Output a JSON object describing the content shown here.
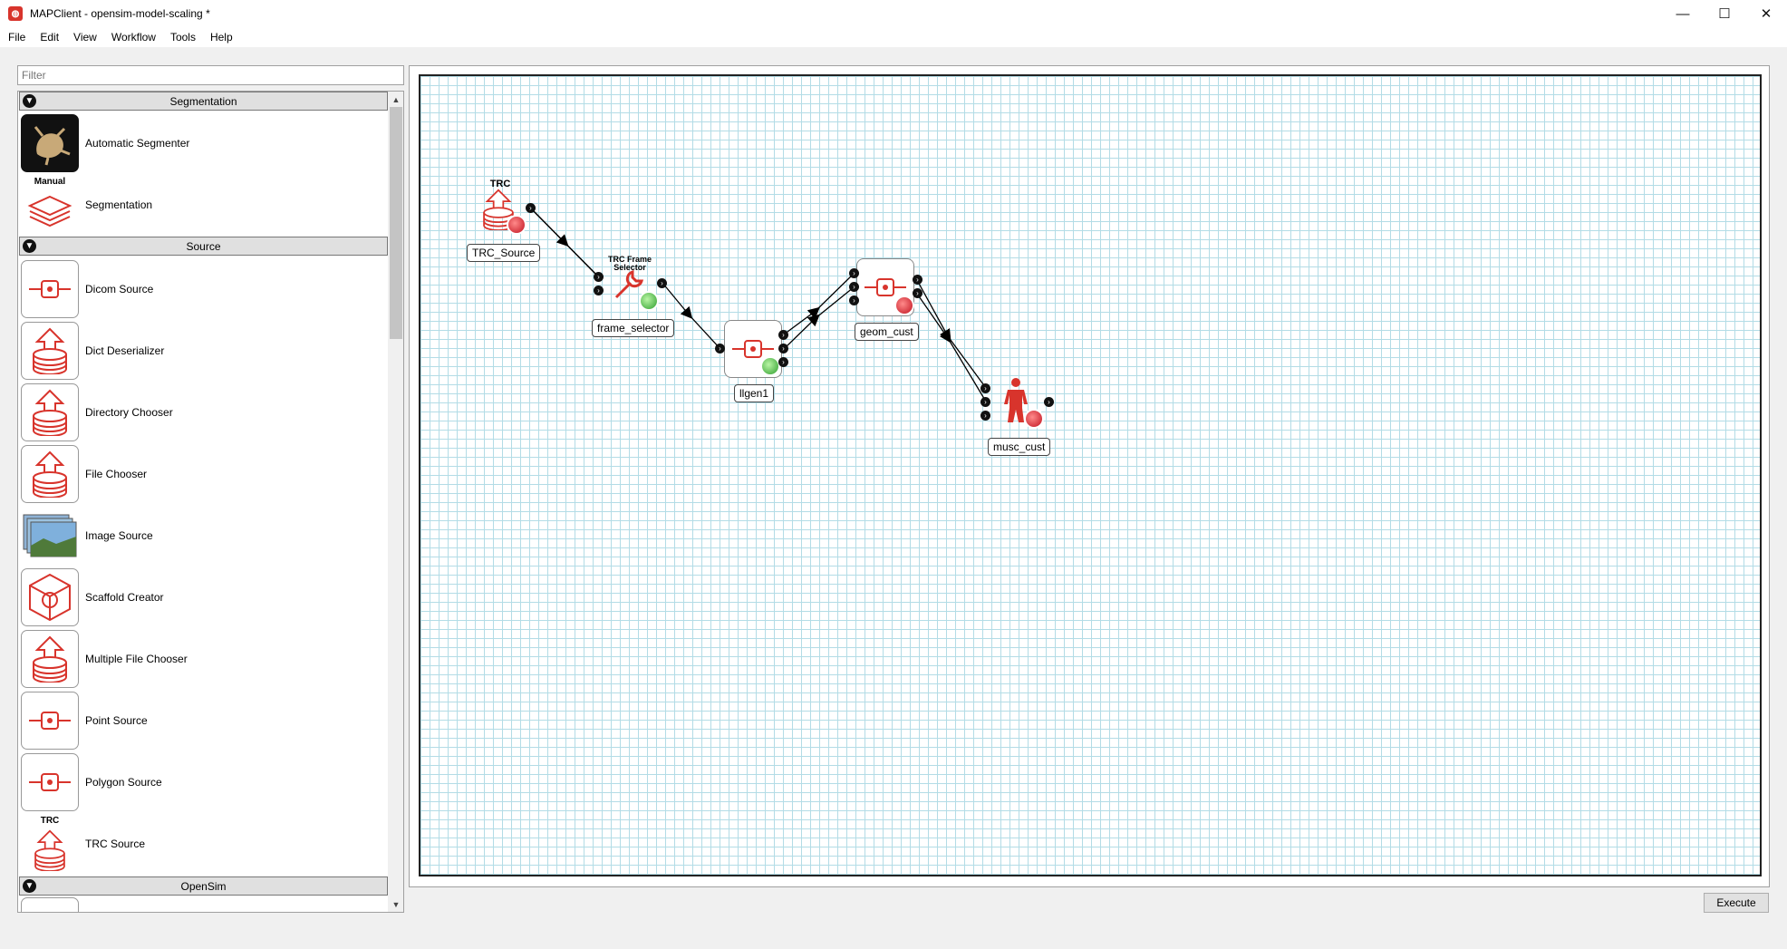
{
  "window": {
    "title": "MAPClient - opensim-model-scaling *",
    "minimize": "—",
    "maximize": "☐",
    "close": "✕"
  },
  "menu": [
    "File",
    "Edit",
    "View",
    "Workflow",
    "Tools",
    "Help"
  ],
  "filter": {
    "placeholder": "Filter"
  },
  "sections": {
    "segmentation": {
      "title": "Segmentation",
      "steps": [
        {
          "label": "Automatic Segmenter",
          "icon": "automatic-segmenter-icon"
        },
        {
          "label": "Segmentation",
          "icon": "segmentation-layers-icon",
          "caption": "Manual"
        }
      ]
    },
    "source": {
      "title": "Source",
      "steps": [
        {
          "label": "Dicom Source",
          "icon": "point-source-icon"
        },
        {
          "label": "Dict Deserializer",
          "icon": "upload-database-icon"
        },
        {
          "label": "Directory Chooser",
          "icon": "upload-database-icon"
        },
        {
          "label": "File Chooser",
          "icon": "upload-database-icon"
        },
        {
          "label": "Image Source",
          "icon": "image-stack-icon"
        },
        {
          "label": "Scaffold Creator",
          "icon": "scaffold-icon"
        },
        {
          "label": "Multiple File Chooser",
          "icon": "upload-database-icon"
        },
        {
          "label": "Point Source",
          "icon": "point-source-icon"
        },
        {
          "label": "Polygon Source",
          "icon": "point-source-icon"
        },
        {
          "label": "TRC Source",
          "icon": "upload-database-icon",
          "caption": "TRC"
        }
      ]
    },
    "opensim": {
      "title": "OpenSim"
    }
  },
  "workflow": {
    "nodes": {
      "trc_source": {
        "label": "TRC_Source",
        "caption": "TRC",
        "icon": "upload-database-icon",
        "status": "red"
      },
      "frame_selector": {
        "label": "frame_selector",
        "caption": "TRC Frame Selector",
        "icon": "wrench-icon",
        "status": "green"
      },
      "llgen1": {
        "label": "llgen1",
        "icon": "point-source-icon",
        "status": "green"
      },
      "geom_cust": {
        "label": "geom_cust",
        "icon": "point-source-icon",
        "status": "red"
      },
      "musc_cust": {
        "label": "musc_cust",
        "icon": "muscle-figure-icon",
        "status": "red"
      }
    },
    "connections": [
      [
        "trc_source",
        "frame_selector"
      ],
      [
        "frame_selector",
        "llgen1"
      ],
      [
        "llgen1",
        "geom_cust"
      ],
      [
        "llgen1",
        "geom_cust"
      ],
      [
        "geom_cust",
        "musc_cust"
      ],
      [
        "geom_cust",
        "musc_cust"
      ]
    ]
  },
  "execute_label": "Execute",
  "colors": {
    "accent": "#d8342c",
    "grid": "#b3dce6",
    "ok": "#2e9e2e"
  }
}
